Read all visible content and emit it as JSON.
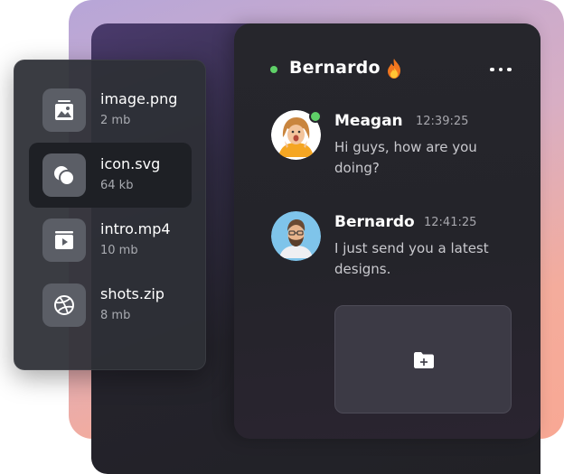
{
  "files": [
    {
      "name": "image.png",
      "size": "2 mb",
      "icon": "image-icon"
    },
    {
      "name": "icon.svg",
      "size": "64 kb",
      "icon": "shapes-icon"
    },
    {
      "name": "intro.mp4",
      "size": "10 mb",
      "icon": "video-icon"
    },
    {
      "name": "shots.zip",
      "size": "8 mb",
      "icon": "dribbble-icon"
    }
  ],
  "chat": {
    "header_name": "Bernardo",
    "header_icon": "fire-icon",
    "messages": [
      {
        "name": "Meagan",
        "time": "12:39:25",
        "text": "Hi guys, how are you doing?"
      },
      {
        "name": "Bernardo",
        "time": "12:41:25",
        "text": "I just send you a latest designs."
      }
    ],
    "attachment_icon": "folder-add-icon"
  },
  "colors": {
    "online": "#5fd068",
    "panel": "#24242a",
    "tile": "#3c3a45"
  }
}
